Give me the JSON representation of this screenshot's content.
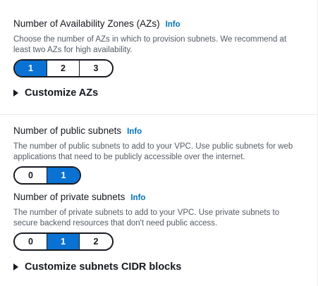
{
  "az": {
    "label": "Number of Availability Zones (AZs)",
    "info": "Info",
    "description": "Choose the number of AZs in which to provision subnets. We recommend at least two AZs for high availability.",
    "options": [
      "1",
      "2",
      "3"
    ],
    "selected": "1"
  },
  "customize_azs": {
    "label": "Customize AZs"
  },
  "public_subnets": {
    "label": "Number of public subnets",
    "info": "Info",
    "description": "The number of public subnets to add to your VPC. Use public subnets for web applications that need to be publicly accessible over the internet.",
    "options": [
      "0",
      "1"
    ],
    "selected": "1"
  },
  "private_subnets": {
    "label": "Number of private subnets",
    "info": "Info",
    "description": "The number of private subnets to add to your VPC. Use private subnets to secure backend resources that don't need public access.",
    "options": [
      "0",
      "1",
      "2"
    ],
    "selected": "1"
  },
  "customize_cidr": {
    "label": "Customize subnets CIDR blocks"
  },
  "colors": {
    "accent": "#0972d3",
    "link": "#0073bb",
    "text": "#16191f",
    "muted": "#545b64"
  }
}
